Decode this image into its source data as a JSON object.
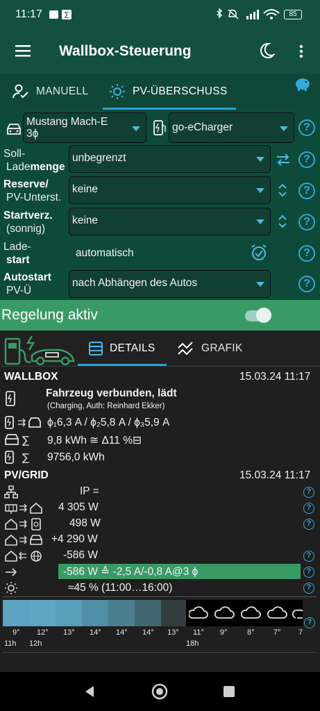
{
  "status_bar": {
    "time": "11:17",
    "battery": "85"
  },
  "app_bar": {
    "title": "Wallbox-Steuerung"
  },
  "tabs": [
    {
      "label": "MANUELL",
      "icon": "person-check-icon"
    },
    {
      "label": "PV-ÜBERSCHUSS",
      "icon": "sun-icon"
    }
  ],
  "vehicle": {
    "value": "Mustang Mach-E\n3ϕ"
  },
  "charger": {
    "value": "go-eCharger"
  },
  "fields": {
    "soll": {
      "label_1": "Soll-",
      "label_2a": "Lade",
      "label_2b": "menge",
      "value": "unbegrenzt"
    },
    "reserve": {
      "label_1": "Reserve/",
      "label_2": "PV-Unterst.",
      "value": "keine"
    },
    "startverz": {
      "label_1": "Startverz.",
      "label_2": "(sonnig)",
      "value": "keine"
    },
    "ladestart": {
      "label_1": "Lade-",
      "label_2": "start",
      "value": "automatisch"
    },
    "autostart": {
      "label_1": "Autostart",
      "label_2": "PV-Ü",
      "value": "nach Abhängen des Autos"
    }
  },
  "regelung": {
    "label": "Regelung aktiv",
    "enabled": true
  },
  "detail_tabs": [
    {
      "label": "DETAILS",
      "icon": "list-icon"
    },
    {
      "label": "GRAFIK",
      "icon": "chart-line-icon"
    }
  ],
  "wallbox": {
    "title": "WALLBOX",
    "timestamp": "15.03.24 11:17",
    "status": "Fahrzeug verbunden, lädt",
    "substatus": "(Charging, Auth: Reinhard Ekker)",
    "phases": "ϕ₁6,3 A / ϕ₂5,8 A / ϕ₃5,9 A",
    "session": "9,8 kWh ≅ Δ11 %⊟",
    "total": "9756,0 kWh"
  },
  "pvgrid": {
    "title": "PV/GRID",
    "timestamp": "15.03.24 11:17",
    "ip": "IP =",
    "pv_to_house": "4 305 W",
    "house_to_battery": "498 W",
    "house_to_car": "+4 290 W",
    "grid": "-586 W",
    "surplus": "-586 W ≙ -2,5 A/-0,8 A@3 ϕ",
    "sun": "≈45 % (11:00…16:00)"
  },
  "weather": {
    "temps": [
      "9°",
      "12°",
      "13°",
      "14°",
      "14°",
      "14°",
      "13°",
      "11°",
      "9°",
      "8°",
      "7°",
      "7"
    ],
    "hours": [
      "11h",
      "12h",
      "18h"
    ],
    "colors": [
      "#5ba3c0",
      "#5fa6c2",
      "#5a9fb9",
      "#4f8ea4",
      "#4a7f90",
      "#42666f",
      "#333d3f"
    ],
    "icons": [
      "cloud-icon",
      "cloud-icon",
      "cloud-icon",
      "cloud-icon",
      "cloud-icon",
      "cloud-icon"
    ]
  }
}
